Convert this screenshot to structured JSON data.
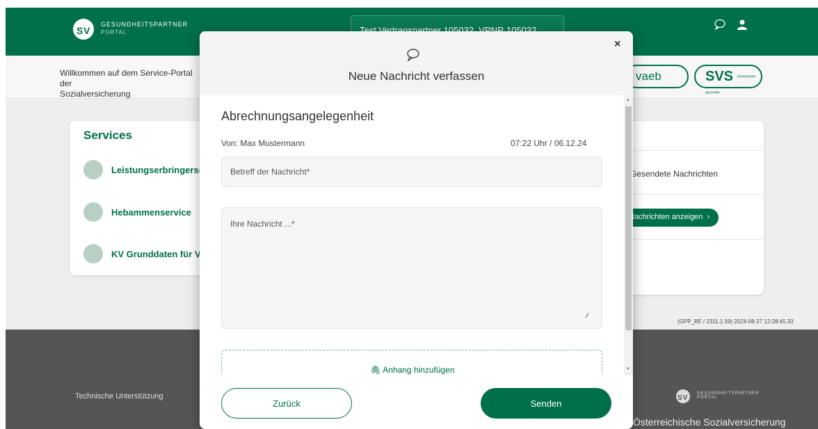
{
  "header": {
    "logo": {
      "line1": "GESUNDHEITSPARTNER",
      "line2": "PORTAL",
      "icon": "sv-logo-icon"
    },
    "partner_select_value": "Test Vertragspartner 105032, VPNR 105032",
    "icons": [
      "chat-icon",
      "user-icon"
    ]
  },
  "subheader": {
    "welcome": "Willkommen auf dem Service-Portal der\nSozialversicherung",
    "brands": {
      "vaeb": "vaeb",
      "svs": "SVS",
      "svs_tag": "Gemeinsam gesünder."
    }
  },
  "services": {
    "title": "Services",
    "items": [
      {
        "label": "Leistungserbringerservice",
        "icon": "service-icon"
      },
      {
        "label": "Hebammenservice",
        "icon": "midwife-icon"
      },
      {
        "label": "KV Grunddaten für Vertragspartner",
        "icon": "data-icon"
      }
    ]
  },
  "messages_panel": {
    "sent_label": "Gesendete Nachrichten",
    "show_button": "Nachrichten anzeigen"
  },
  "version": "(GPP_BE / 2311.1.59) 2024-08-27 12:28:45.33",
  "footer": {
    "support": "Technische Unterstützung",
    "logo_line1": "GESUNDHEITSPARTNER",
    "logo_line2": "PORTAL",
    "org": "Österreichische Sozialversicherung"
  },
  "modal": {
    "title": "Neue Nachricht verfassen",
    "close": "×",
    "heading": "Abrechnungsangelegenheit",
    "from": "Von: Max Mustermann",
    "timestamp": "07:22 Uhr / 06.12.24",
    "subject_placeholder": "Betreff der Nachricht*",
    "message_placeholder": "Ihre Nachricht ...*",
    "attach_label": "Anhang hinzufügen",
    "back_label": "Zurück",
    "send_label": "Senden"
  },
  "colors": {
    "primary": "#00704a",
    "footer": "#555555",
    "page": "#eeeeee"
  }
}
